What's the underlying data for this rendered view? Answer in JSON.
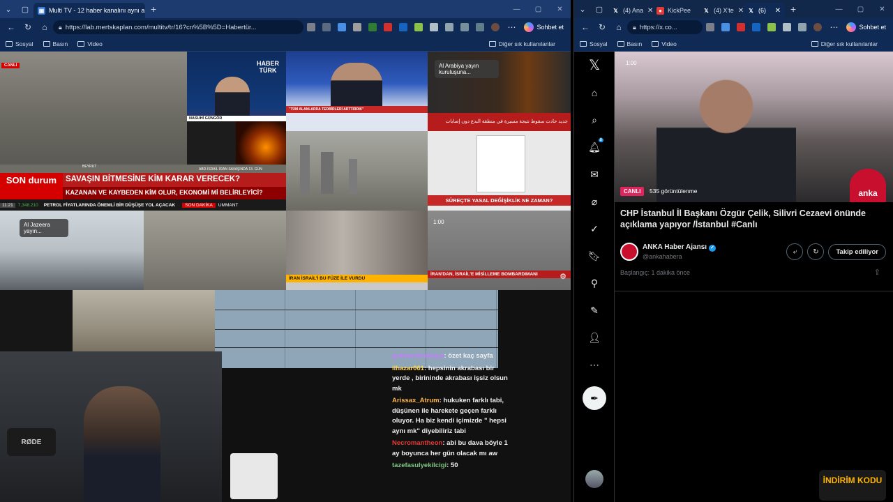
{
  "left_window": {
    "tabs": [
      {
        "title": "Multi TV - 12 haber kanalını aynı a",
        "active": true
      }
    ],
    "address": "https://lab.mertskaplan.com/multitv/tr/16?cn%5B%5D=Habertür...",
    "copilot_label": "Sohbet et",
    "bookmarks": [
      "Sosyal",
      "Basın",
      "Video"
    ],
    "bookmarks_right": "Diğer sık kullanılanlar",
    "tiles": {
      "live_badge": "CANLI",
      "haberturk_logo": "HABER TÜRK",
      "haberturk_name": "NASUHİ GÜNGÖR",
      "haberturk_caption": "ABD-İSRAİL İRAN SAVAŞINDA 13. GÜN",
      "beyrut": "BEYRUT",
      "son_durum": "SON durum",
      "headline1": "SAVAŞIN BİTMESİNE KİM KARAR VERECEK?",
      "headline2": "KAZANAN VE KAYBEDEN KİM OLUR, EKONOMİ Mİ BELİRLEYİCİ?",
      "ticker": "PETROL FİYATLARINDA ÖNEMLİ BİR DÜŞÜŞE YOL AÇACAK",
      "ticker_time": "11:21",
      "ticker_value": "7,348.210",
      "ticker_tag": "SON DAKİKA",
      "ticker_tail": "UMMANT",
      "tvnet_caption": "\"TÜM ALANLARDA TEDBİRLERİ ARTTIRDIK\"",
      "alarabiya_overlay": "Al Arabiya yayın kuruluşuna...",
      "alarabiya_caption": "جديد حادث سقوط نتيجة مسيرة في منطقة البدع دون إصابات",
      "surecte": "SÜREÇTE YASAL DEĞİŞİKLİK NE ZAMAN?",
      "aljazeera_overlay": "Al Jazeera yayın...",
      "iran_israil": "İRAN İSRAİL'İ BU FÜZE İLE VURDU",
      "iran_misilleme": "İRAN'DAN, İSRAİL'E MİSİLLEME BOMBARDIMANI",
      "dakika": "1:00"
    },
    "webcam": {
      "mic_brand": "RØDE"
    },
    "chat": [
      {
        "user": "gokhankiralkaya",
        "text": "özet kaç sayfa",
        "color": "#c77dff"
      },
      {
        "user": "ilhazar061",
        "text": "hepsinin akrabası bir yerde , birininde akrabası işsiz olsun mk",
        "color": "#ffd54f"
      },
      {
        "user": "Arissax_Atrum",
        "text": "hukuken farklı tabi, düşünen ile harekete geçen farklı oluyor. Ha biz kendi içimizde \" hepsi aynı mk\" diyebiliriz tabi",
        "color": "#ffb74d"
      },
      {
        "user": "Necromantheon",
        "text": "abi bu dava böyle 1 ay boyunca her gün olacak mı aw",
        "color": "#e53935"
      },
      {
        "user": "tazefasulyekilcigi",
        "text": "50",
        "color": "#81c784"
      }
    ]
  },
  "right_window": {
    "tabs": [
      {
        "title": "(4) Ana",
        "active": false
      },
      {
        "title": "KickPee",
        "active": false
      },
      {
        "title": "(4) X'te",
        "active": false
      },
      {
        "title": "(6)",
        "active": true
      }
    ],
    "address": "https://x.co...",
    "copilot_label": "Sohbet et",
    "bookmarks": [
      "Sosyal",
      "Basın",
      "Video"
    ],
    "bookmarks_right": "Diğer sık kullanılanlar",
    "notif_count": "8",
    "post": {
      "video_time": "1:00",
      "live_label": "CANLI",
      "views": "535 görüntülenme",
      "logo_text": "anka",
      "title": "CHP İstanbul İl Başkanı Özgür Çelik, Silivri Cezaevi önünde açıklama yapıyor /İstanbul #Canlı",
      "author_name": "ANKA Haber Ajansı",
      "author_handle": "@ankahabera",
      "follow_label": "Takip ediliyor",
      "started": "Başlangıç: 1 dakika önce"
    },
    "promo": "İNDİRİM KODU"
  }
}
